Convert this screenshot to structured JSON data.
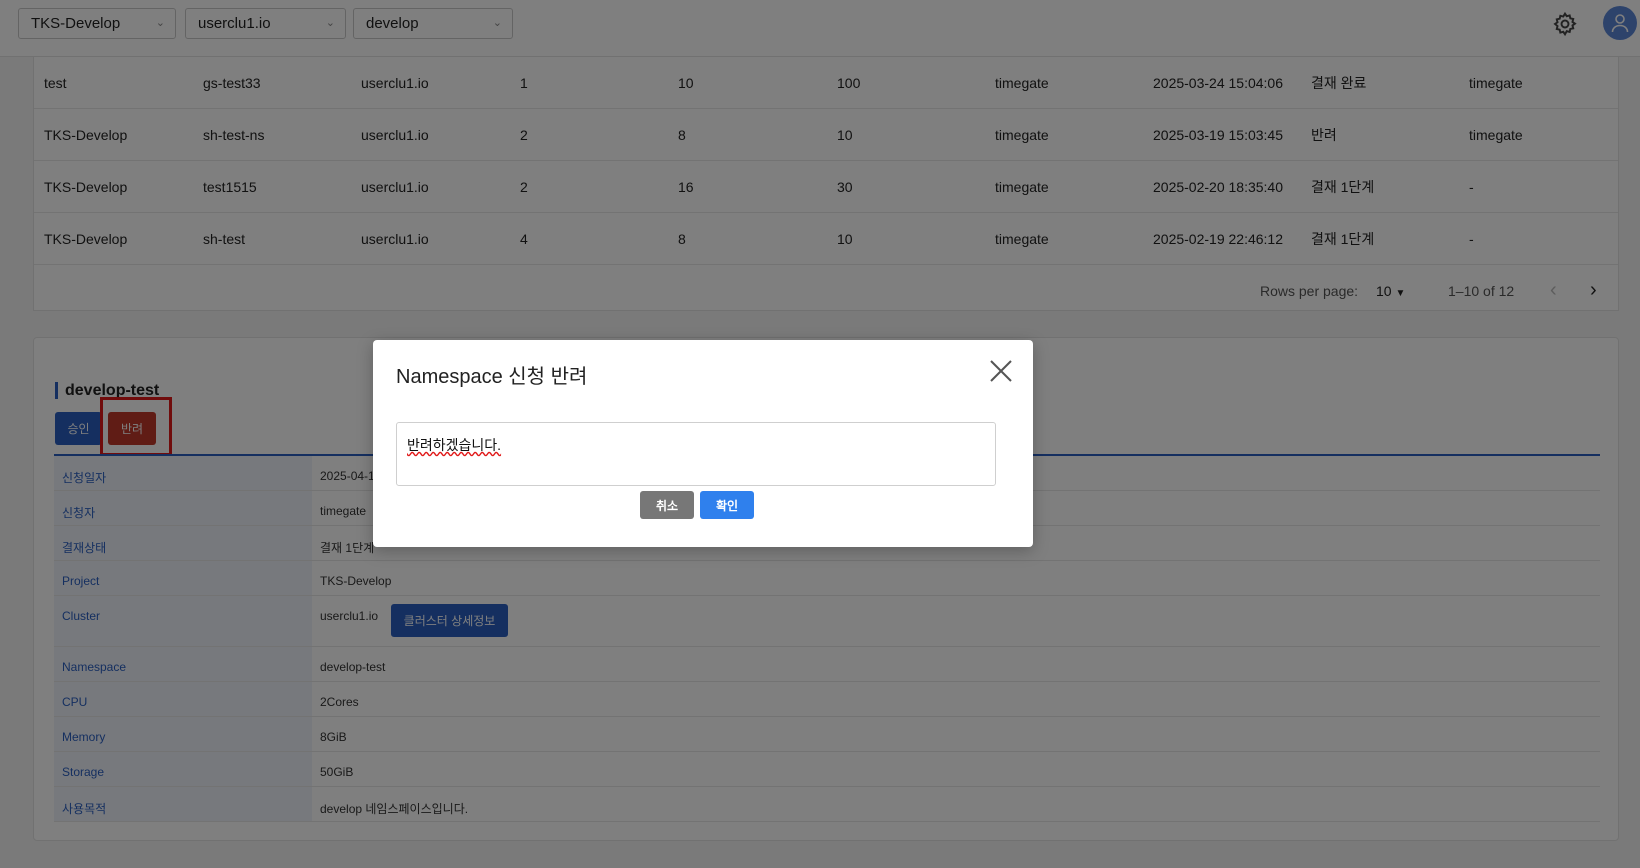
{
  "topbar": {
    "project": "TKS-Develop",
    "cluster": "userclu1.io",
    "namespace": "develop"
  },
  "table": {
    "rows": [
      [
        "test",
        "gs-test33",
        "userclu1.io",
        "1",
        "10",
        "100",
        "timegate",
        "2025-03-24 15:04:06",
        "결재 완료",
        "timegate"
      ],
      [
        "TKS-Develop",
        "sh-test-ns",
        "userclu1.io",
        "2",
        "8",
        "10",
        "timegate",
        "2025-03-19 15:03:45",
        "반려",
        "timegate"
      ],
      [
        "TKS-Develop",
        "test1515",
        "userclu1.io",
        "2",
        "16",
        "30",
        "timegate",
        "2025-02-20 18:35:40",
        "결재 1단계",
        "-"
      ],
      [
        "TKS-Develop",
        "sh-test",
        "userclu1.io",
        "4",
        "8",
        "10",
        "timegate",
        "2025-02-19 22:46:12",
        "결재 1단계",
        "-"
      ]
    ],
    "rows_per_page_label": "Rows per page:",
    "rows_per_page_value": "10",
    "range": "1–10 of 12"
  },
  "detail": {
    "title": "develop-test",
    "approve_label": "승인",
    "reject_label": "반려",
    "fields": [
      {
        "key": "신청일자",
        "value": "2025-04-1"
      },
      {
        "key": "신청자",
        "value": "timegate"
      },
      {
        "key": "결재상태",
        "value": "결재 1단계"
      },
      {
        "key": "Project",
        "value": "TKS-Develop"
      },
      {
        "key": "Cluster",
        "value": "userclu1.io"
      },
      {
        "key": "Namespace",
        "value": "develop-test"
      },
      {
        "key": "CPU",
        "value": "2Cores"
      },
      {
        "key": "Memory",
        "value": "8GiB"
      },
      {
        "key": "Storage",
        "value": "50GiB"
      },
      {
        "key": "사용목적",
        "value": "develop 네임스페이스입니다."
      }
    ],
    "cluster_detail_button": "클러스터 상세정보"
  },
  "modal": {
    "title": "Namespace 신청 반려",
    "input_value": "반려하겠습니다.",
    "cancel_label": "취소",
    "confirm_label": "확인"
  },
  "colors": {
    "primary": "#2a5fc1",
    "reject": "#c0392b",
    "confirm": "#2f80ed",
    "highlight": "#e01818"
  }
}
